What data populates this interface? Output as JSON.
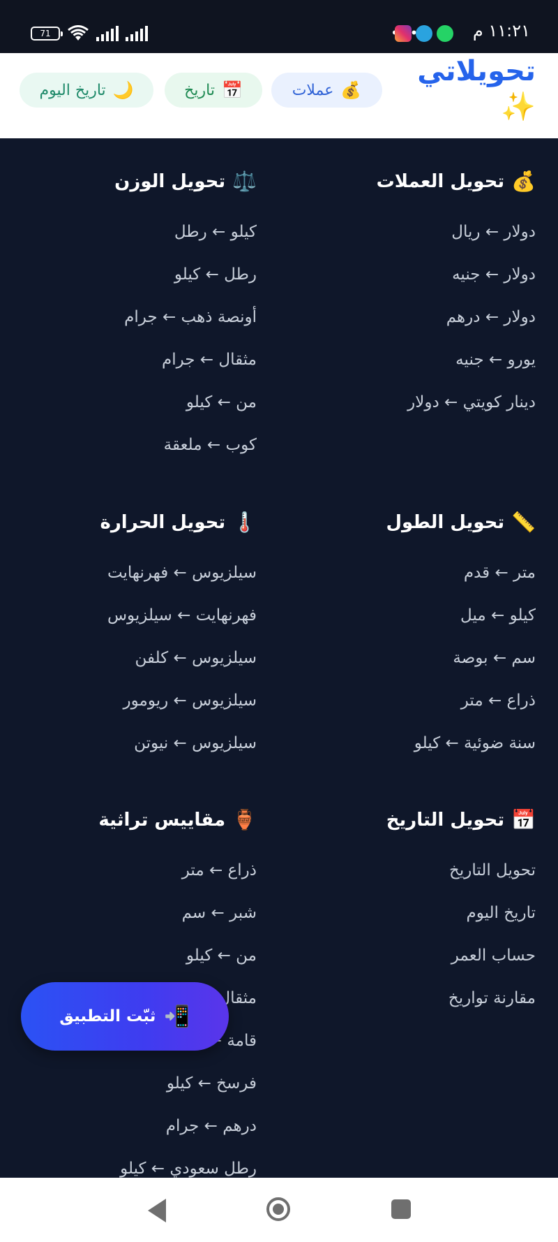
{
  "status_bar": {
    "time": "١١:٢١ م",
    "more_dots": "•••",
    "battery_level": "71"
  },
  "header": {
    "brand_title": "تحويلاتي",
    "brand_icon": "✨",
    "pills": [
      {
        "icon": "💰",
        "label": "عملات"
      },
      {
        "icon": "📅",
        "label": "تاريخ"
      },
      {
        "icon": "🌙",
        "label": "تاريخ اليوم"
      }
    ]
  },
  "sections": {
    "currency": {
      "icon": "💰",
      "title": "تحويل العملات",
      "items": [
        "دولار ← ريال",
        "دولار ← جنيه",
        "دولار ← درهم",
        "يورو ← جنيه",
        "دينار كويتي ← دولار"
      ]
    },
    "weight": {
      "icon": "⚖️",
      "title": "تحويل الوزن",
      "items": [
        "كيلو ← رطل",
        "رطل ← كيلو",
        "أونصة ذهب ← جرام",
        "مثقال ← جرام",
        "من ← كيلو",
        "كوب ← ملعقة"
      ]
    },
    "length": {
      "icon": "📏",
      "title": "تحويل الطول",
      "items": [
        "متر ← قدم",
        "كيلو ← ميل",
        "سم ← بوصة",
        "ذراع ← متر",
        "سنة ضوئية ← كيلو"
      ]
    },
    "temperature": {
      "icon": "🌡️",
      "title": "تحويل الحرارة",
      "items": [
        "سيلزيوس ← فهرنهايت",
        "فهرنهايت ← سيلزيوس",
        "سيلزيوس ← كلفن",
        "سيلزيوس ← ريومور",
        "سيلزيوس ← نيوتن"
      ]
    },
    "date": {
      "icon": "📅",
      "title": "تحويل التاريخ",
      "items": [
        "تحويل التاريخ",
        "تاريخ اليوم",
        "حساب العمر",
        "مقارنة تواريخ"
      ]
    },
    "heritage": {
      "icon": "🏺",
      "title": "مقاييس تراثية",
      "items": [
        "ذراع ← متر",
        "شبر ← سم",
        "من ← كيلو",
        "مثقال ← جرام",
        "قامة ← متر",
        "فرسخ ← كيلو",
        "درهم ← جرام",
        "رطل سعودي ← كيلو"
      ]
    }
  },
  "install_button": {
    "icon": "📲",
    "label": "ثبّت التطبيق"
  },
  "colors": {
    "background": "#0f172a",
    "brand_blue": "#2563eb",
    "install_gradient_start": "#2b52f4",
    "install_gradient_end": "#5a35ea"
  }
}
